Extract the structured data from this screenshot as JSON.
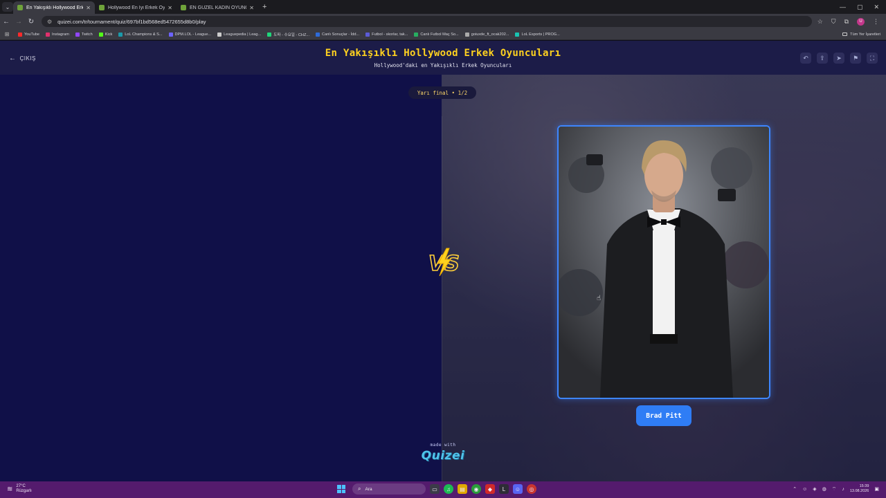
{
  "browser": {
    "tabs": [
      {
        "title": "En Yakışıklı Hollywood Erkek O",
        "active": true
      },
      {
        "title": "Hollywood En İyi Erkek Oyuncu",
        "active": false
      },
      {
        "title": "EN GÜZEL KADIN OYUNCU KİM",
        "active": false
      }
    ],
    "new_tab": "+",
    "url": "quizei.com/tr/tournament/quiz/697bf1bd568ed5472655d8b0/play",
    "bookmarks": [
      {
        "label": "YouTube",
        "color": "#ff2a2a"
      },
      {
        "label": "Instagram",
        "color": "#e1306c"
      },
      {
        "label": "Twitch",
        "color": "#9146ff"
      },
      {
        "label": "Kick",
        "color": "#53fc18"
      },
      {
        "label": "LoL Champions & S...",
        "color": "#1b9aaa"
      },
      {
        "label": "DPM.LOL - League...",
        "color": "#6c63ff"
      },
      {
        "label": "Leaguepedia | Leag...",
        "color": "#cccccc"
      },
      {
        "label": "도파 - 수요일 - CHZ...",
        "color": "#1fd67a"
      },
      {
        "label": "Canlı Sonuçlar - İdd...",
        "color": "#2e6bd9"
      },
      {
        "label": "Futbol - skorlar, tak...",
        "color": "#5b5bd6"
      },
      {
        "label": "Canlı Futbol Maç So...",
        "color": "#27ae60"
      },
      {
        "label": "goiuxde_ft_ocak202...",
        "color": "#aaaaaa"
      },
      {
        "label": "LoL Esports | PROG...",
        "color": "#19c3b1"
      }
    ],
    "all_bookmarks": "Tüm Yer İşaretleri",
    "profile_initial": "U"
  },
  "page": {
    "exit_label": "ÇIKIŞ",
    "title": "En Yakışıklı Hollywood Erkek Oyuncuları",
    "subtitle": "Hollywood'daki en Yakışıklı Erkek Oyuncuları",
    "stage": "Yarı final • 1/2",
    "vs_text": "VS",
    "candidate_name": "Brad Pitt",
    "made_with": "made with",
    "logo_text": "Quizei",
    "accent": "#ffd21f",
    "button_color": "#2f7df5"
  },
  "taskbar": {
    "temperature": "27°C",
    "weather_desc": "Rüzgarlı",
    "search_placeholder": "Ara",
    "time": "15:39",
    "date": "13.08.2026"
  }
}
